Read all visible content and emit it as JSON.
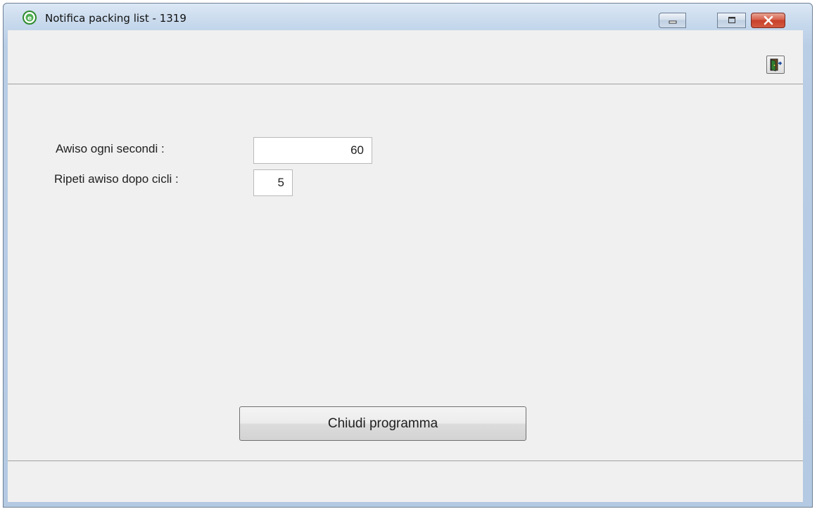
{
  "window": {
    "title": "Notifica packing list - 1319",
    "app_icon": "app-logo-e-icon",
    "controls": {
      "minimize_icon": "minimize-icon",
      "maximize_icon": "maximize-icon",
      "close_icon": "close-icon"
    }
  },
  "toolbar": {
    "exit_icon": "exit-door-icon"
  },
  "form": {
    "awiso_label": "Awiso ogni secondi :",
    "awiso_value": "60",
    "ripeti_label": "Ripeti awiso dopo cicli :",
    "ripeti_value": "5"
  },
  "actions": {
    "close_program_label": "Chiudi programma"
  },
  "colors": {
    "close_button": "#c8402a",
    "app_icon_green": "#2e8b2e",
    "window_frame": "#b9cde5",
    "client_bg": "#f0f0f0"
  }
}
